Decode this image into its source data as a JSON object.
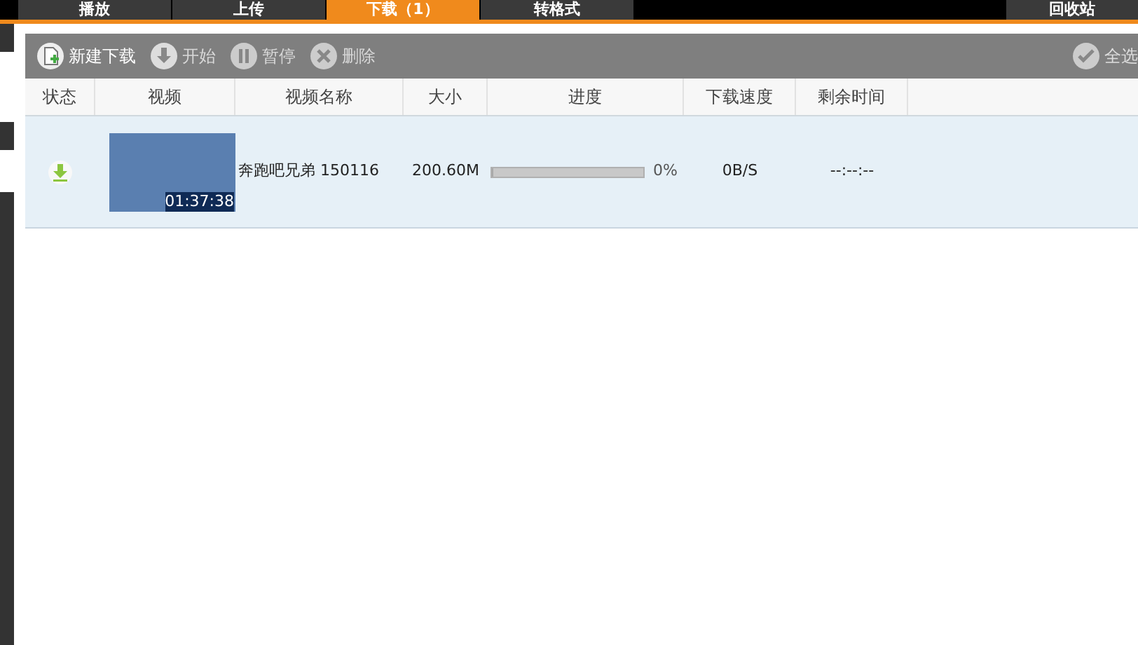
{
  "tabs": [
    {
      "label": "播放",
      "selected": false
    },
    {
      "label": "上传",
      "selected": false
    },
    {
      "label": "下载（1）",
      "selected": true
    },
    {
      "label": "转格式",
      "selected": false
    }
  ],
  "recycle_tab": {
    "label": "回收站"
  },
  "toolbar": {
    "buttons": [
      {
        "kind": "new",
        "label": "新建下载",
        "disabled": false
      },
      {
        "kind": "start",
        "label": "开始",
        "disabled": true
      },
      {
        "kind": "pause",
        "label": "暂停",
        "disabled": true
      },
      {
        "kind": "delete",
        "label": "删除",
        "disabled": true
      }
    ],
    "select_all": "全选"
  },
  "table": {
    "columns": [
      "状态",
      "视频",
      "视频名称",
      "大小",
      "进度",
      "下载速度",
      "剩余时间"
    ],
    "rows": [
      {
        "duration": "01:37:38",
        "name": "奔跑吧兄弟 150116",
        "size": "200.60M",
        "level": 0,
        "percent": "0%",
        "speed": "0B/S",
        "remaining": "--:--:--",
        "selected": true
      }
    ]
  }
}
